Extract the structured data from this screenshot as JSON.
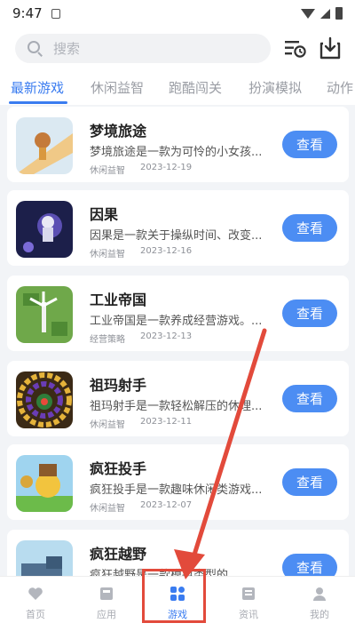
{
  "status_bar": {
    "time": "9:47"
  },
  "search": {
    "placeholder": "搜索"
  },
  "tabs": [
    {
      "label": "最新游戏",
      "active": true
    },
    {
      "label": "休闲益智",
      "active": false
    },
    {
      "label": "跑酷闯关",
      "active": false
    },
    {
      "label": "扮演模拟",
      "active": false
    },
    {
      "label": "动作",
      "active": false
    }
  ],
  "games": [
    {
      "title": "梦境旅途",
      "desc": "梦境旅途是一款为可怜的小女孩...",
      "category": "休闲益智",
      "date": "2023-12-19",
      "button": "查看"
    },
    {
      "title": "因果",
      "desc": "因果是一款关于操纵时间、改变...",
      "category": "休闲益智",
      "date": "2023-12-16",
      "button": "查看"
    },
    {
      "title": "工业帝国",
      "desc": "工业帝国是一款养成经营游戏。...",
      "category": "经营策略",
      "date": "2023-12-13",
      "button": "查看"
    },
    {
      "title": "祖玛射手",
      "desc": "祖玛射手是一款轻松解压的休理...",
      "category": "休闲益智",
      "date": "2023-12-11",
      "button": "查看"
    },
    {
      "title": "疯狂投手",
      "desc": "疯狂投手是一款趣味休闲类游戏...",
      "category": "休闲益智",
      "date": "2023-12-07",
      "button": "查看"
    },
    {
      "title": "疯狂越野",
      "desc": "疯狂越野是一款模拟类型的...",
      "category": "",
      "date": "",
      "button": "查看"
    }
  ],
  "bottom_nav": [
    {
      "label": "首页",
      "icon": "heart-icon",
      "active": false
    },
    {
      "label": "应用",
      "icon": "app-icon",
      "active": false
    },
    {
      "label": "游戏",
      "icon": "grid-icon",
      "active": true
    },
    {
      "label": "资讯",
      "icon": "news-icon",
      "active": false
    },
    {
      "label": "我的",
      "icon": "profile-icon",
      "active": false
    }
  ],
  "colors": {
    "accent": "#3a7cf0",
    "button": "#4c8df3",
    "annotation": "#e24a3b"
  }
}
